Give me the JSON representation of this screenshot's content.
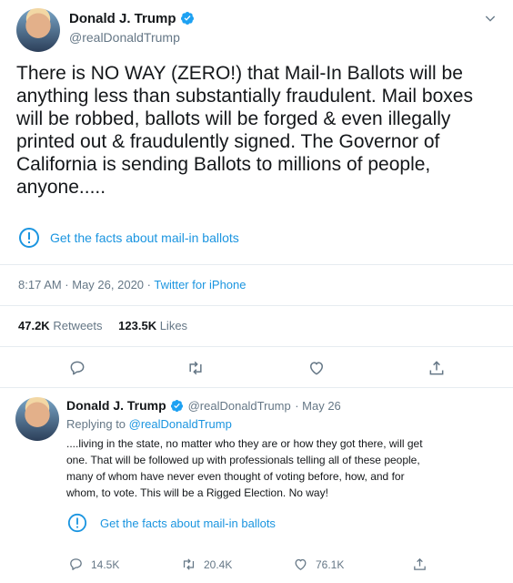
{
  "main_tweet": {
    "author_name": "Donald J. Trump",
    "author_handle": "@realDonaldTrump",
    "text_lines": [
      "There is NO WAY (ZERO!) that Mail-In Ballots will be",
      "anything less than substantially fraudulent. Mail boxes",
      "will be robbed, ballots will be forged & even illegally",
      "printed out & fraudulently signed. The Governor of",
      "California is sending Ballots to millions of people,",
      "anyone....."
    ],
    "fact_check_label": "Get the facts about mail-in ballots",
    "time": "8:17 AM · May 26, 2020 · ",
    "source": "Twitter for iPhone",
    "retweets_count": "47.2K",
    "retweets_label": "Retweets",
    "likes_count": "123.5K",
    "likes_label": "Likes"
  },
  "reply_tweet": {
    "author_name": "Donald J. Trump",
    "author_handle": "@realDonaldTrump",
    "date": "· May 26",
    "replying_prefix": "Replying to ",
    "replying_to": "@realDonaldTrump",
    "text_lines": [
      "....living in the state, no matter who they are or how they got there, will get",
      "one. That will be followed up with professionals telling all of these people,",
      "many of whom have never even thought of voting before, how, and for",
      "whom, to vote. This will be a Rigged Election. No way!"
    ],
    "fact_check_label": "Get the facts about mail-in ballots",
    "reply_count": "14.5K",
    "retweet_count": "20.4K",
    "like_count": "76.1K"
  },
  "colors": {
    "accent": "#1b95e0",
    "muted": "#657786",
    "divider": "#e6ecf0"
  },
  "icons": [
    "verified-badge-icon",
    "chevron-down-icon",
    "info-icon",
    "reply-icon",
    "retweet-icon",
    "like-icon",
    "share-icon"
  ]
}
